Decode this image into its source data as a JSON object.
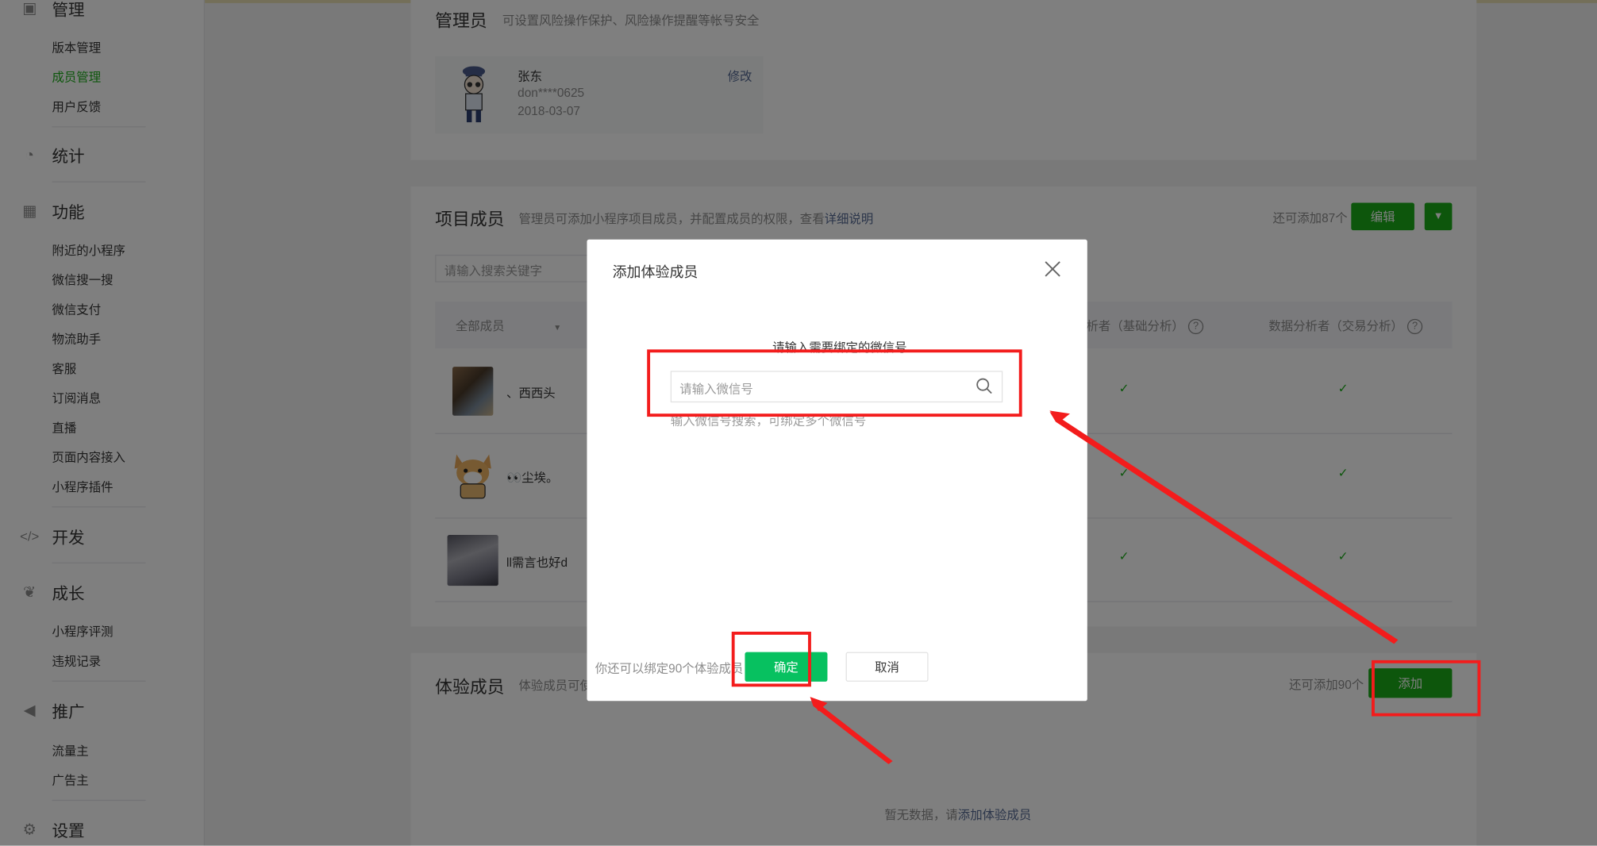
{
  "sidebar": {
    "sections": [
      {
        "label": "管理",
        "icon": "manage-icon",
        "items": [
          "版本管理",
          "成员管理",
          "用户反馈"
        ]
      },
      {
        "label": "统计",
        "icon": "pie-chart-icon",
        "items": []
      },
      {
        "label": "功能",
        "icon": "grid-icon",
        "items": [
          "附近的小程序",
          "微信搜一搜",
          "微信支付",
          "物流助手",
          "客服",
          "订阅消息",
          "直播",
          "页面内容接入",
          "小程序插件"
        ]
      },
      {
        "label": "开发",
        "icon": "code-icon",
        "items": []
      },
      {
        "label": "成长",
        "icon": "sprout-icon",
        "items": [
          "小程序评测",
          "违规记录"
        ]
      },
      {
        "label": "推广",
        "icon": "megaphone-icon",
        "items": [
          "流量主",
          "广告主"
        ]
      },
      {
        "label": "设置",
        "icon": "gear-icon",
        "items": []
      }
    ],
    "active_item": "成员管理"
  },
  "admin": {
    "title": "管理员",
    "desc": "可设置风险操作保护、风险操作提醒等帐号安全",
    "name": "张东",
    "account": "don****0625",
    "date": "2018-03-07",
    "edit": "修改"
  },
  "project": {
    "title": "项目成员",
    "desc_prefix": "管理员可添加小程序项目成员，并配置成员的权限，查看",
    "desc_link": "详细说明",
    "remaining": "还可添加87个",
    "edit_button": "编辑",
    "search_placeholder": "请输入搜索关键字",
    "filter": "全部成员",
    "col_basic": "析者（基础分析）",
    "col_trade": "数据分析者（交易分析）",
    "members": [
      {
        "name": "、西西头"
      },
      {
        "name": "👀尘埃。"
      },
      {
        "name": "ll需言也好d"
      }
    ]
  },
  "trial": {
    "title": "体验成员",
    "desc": "体验成员可使",
    "remaining": "还可添加90个",
    "add_button": "添加",
    "empty_prefix": "暂无数据，请",
    "empty_link": "添加体验成员"
  },
  "modal": {
    "title": "添加体验成员",
    "prompt": "请输入需要绑定的微信号",
    "input_placeholder": "请输入微信号",
    "hint": "输入微信号搜索，可绑定多个微信号",
    "footer_note": "你还可以绑定90个体验成员",
    "confirm": "确定",
    "cancel": "取消"
  },
  "colors": {
    "brand_green": "#1aad19",
    "confirm_green": "#07c160",
    "annotation_red": "#f31c1c",
    "link": "#576b95"
  }
}
